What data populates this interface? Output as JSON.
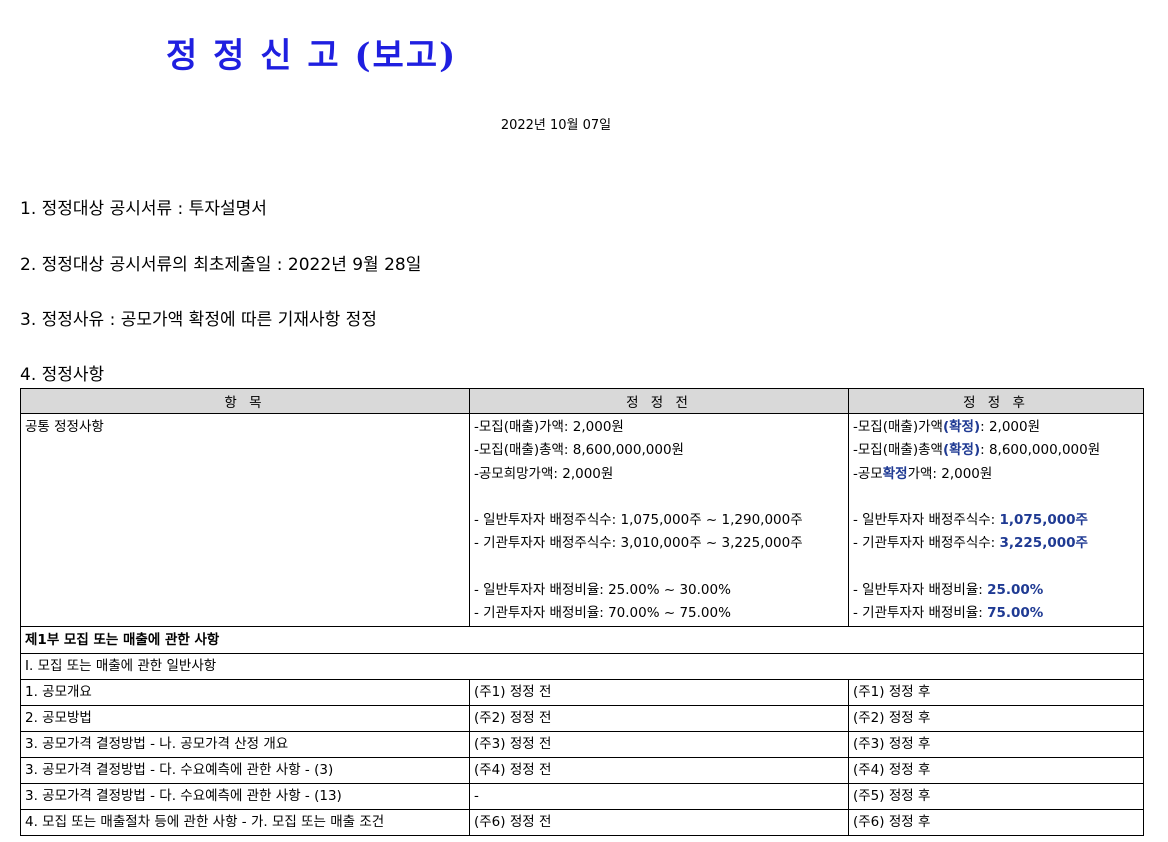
{
  "title": "정 정 신 고 (보고)",
  "date": "2022년 10월 07일",
  "items": [
    "1. 정정대상 공시서류 : 투자설명서",
    "2. 정정대상 공시서류의 최초제출일 : 2022년 9월 28일",
    "3. 정정사유 : 공모가액 확정에 따른 기재사항 정정",
    "4. 정정사항"
  ],
  "table": {
    "headers": [
      "항 목",
      "정 정 전",
      "정 정 후"
    ],
    "common": {
      "label": "공통 정정사항",
      "before": [
        "-모집(매출)가액: 2,000원",
        "-모집(매출)총액: 8,600,000,000원",
        "-공모희망가액: 2,000원",
        "",
        "- 일반투자자 배정주식수: 1,075,000주 ~ 1,290,000주",
        "- 기관투자자 배정주식수: 3,010,000주 ~ 3,225,000주",
        "",
        "- 일반투자자 배정비율: 25.00% ~ 30.00%",
        "- 기관투자자 배정비율: 70.00% ~ 75.00%"
      ],
      "after": {
        "l1_pre": "-모집(매출)가액",
        "l1_hl": "(확정)",
        "l1_post": ": 2,000원",
        "l2_pre": "-모집(매출)총액",
        "l2_hl": "(확정)",
        "l2_post": ": 8,600,000,000원",
        "l3_pre": "-공모",
        "l3_hl": "확정",
        "l3_post": "가액: 2,000원",
        "l4_pre": "- 일반투자자 배정주식수: ",
        "l4_hl": "1,075,000주",
        "l5_pre": "- 기관투자자 배정주식수: ",
        "l5_hl": "3,225,000주",
        "l6_pre": "- 일반투자자 배정비율: ",
        "l6_hl": "25.00%",
        "l7_pre": "- 기관투자자 배정비율: ",
        "l7_hl": "75.00%"
      }
    },
    "section1": "제1부 모집 또는 매출에 관한 사항",
    "section2": "I. 모집 또는 매출에 관한 일반사항",
    "rows": [
      {
        "item": "1. 공모개요",
        "before": "(주1) 정정 전",
        "after": "(주1) 정정 후"
      },
      {
        "item": "2. 공모방법",
        "before": "(주2) 정정 전",
        "after": "(주2) 정정 후"
      },
      {
        "item": "3. 공모가격 결정방법 - 나. 공모가격 산정 개요",
        "before": "(주3) 정정 전",
        "after": "(주3) 정정 후"
      },
      {
        "item": "3. 공모가격 결정방법 - 다. 수요예측에 관한 사항 - (3)",
        "before": "(주4) 정정 전",
        "after": "(주4) 정정 후"
      },
      {
        "item": "3. 공모가격 결정방법 - 다. 수요예측에 관한 사항 - (13)",
        "before": "-",
        "after": "(주5) 정정 후"
      },
      {
        "item": "4. 모집 또는 매출절차 등에 관한 사항 - 가. 모집 또는 매출 조건",
        "before": "(주6) 정정 전",
        "after": "(주6) 정정 후"
      }
    ]
  },
  "colors": {
    "title": "#1f1fe0",
    "highlight": "#1f3a93",
    "header_bg": "#d9d9d9"
  }
}
